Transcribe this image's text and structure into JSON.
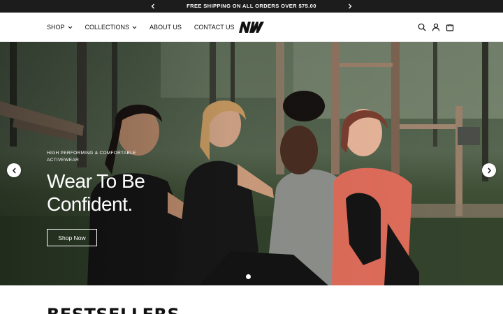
{
  "announcement": {
    "text": "FREE SHIPPING ON ALL ORDERS OVER $75.00",
    "prev_icon": "chevron-left-icon",
    "next_icon": "chevron-right-icon"
  },
  "header": {
    "nav": [
      {
        "label": "SHOP",
        "has_dropdown": true
      },
      {
        "label": "COLLECTIONS",
        "has_dropdown": true
      },
      {
        "label": "ABOUT US",
        "has_dropdown": false
      },
      {
        "label": "CONTACT US",
        "has_dropdown": false
      }
    ],
    "logo_text": "NW",
    "icons": [
      "search-icon",
      "account-icon",
      "cart-icon"
    ]
  },
  "hero": {
    "eyebrow": "HIGH PERFORMING & COMFORTABLE ACTIVEWEAR",
    "title": "Wear To Be Confident.",
    "button_label": "Shop Now",
    "slide_count": 1,
    "active_slide": 1
  },
  "bestsellers": {
    "title": "BESTSELLERS"
  },
  "colors": {
    "announcement_bg": "#1c1c1c",
    "text": "#111111",
    "white": "#ffffff"
  }
}
